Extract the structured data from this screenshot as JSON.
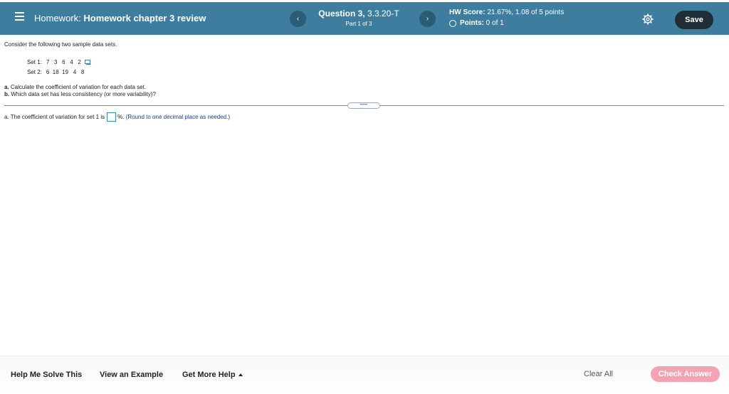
{
  "header": {
    "title_prefix": "Homework:",
    "title_name": "Homework chapter 3 review",
    "prev_label": "‹",
    "next_label": "›",
    "question_label": "Question 3,",
    "question_id": "3.3.20-T",
    "part": "Part 1 of 3",
    "hw_score_label": "HW Score:",
    "hw_score_value": "21.67%, 1.08 of 5 points",
    "points_label": "Points:",
    "points_value": "0 of 1",
    "save_label": "Save"
  },
  "problem": {
    "intro": "Consider the following two sample data sets.",
    "sets": [
      {
        "label": "Set 1:",
        "values": "7   3   6   4   2"
      },
      {
        "label": "Set 2:",
        "values": "6  18  19   4   8"
      }
    ],
    "part_a_letter": "a.",
    "part_a_text": "Calculate the coefficient of variation for each data set.",
    "part_b_letter": "b.",
    "part_b_text": "Which data set has less consistency (or more variability)?",
    "handle_label": "•••••"
  },
  "answer": {
    "prefix": "a. The coefficient of variation for set 1 is",
    "value": "",
    "suffix": "%.",
    "hint": "(Round to one decimal place as needed.)"
  },
  "footer": {
    "help_solve": "Help Me Solve This",
    "view_example": "View an Example",
    "get_more_help": "Get More Help",
    "clear_all": "Clear All",
    "check_answer": "Check Answer"
  },
  "colors": {
    "header_bg": "#3e7d9e",
    "save_bg": "#1f2d36",
    "check_bg": "#f3a4b3",
    "hint_text": "#1b3a86"
  }
}
